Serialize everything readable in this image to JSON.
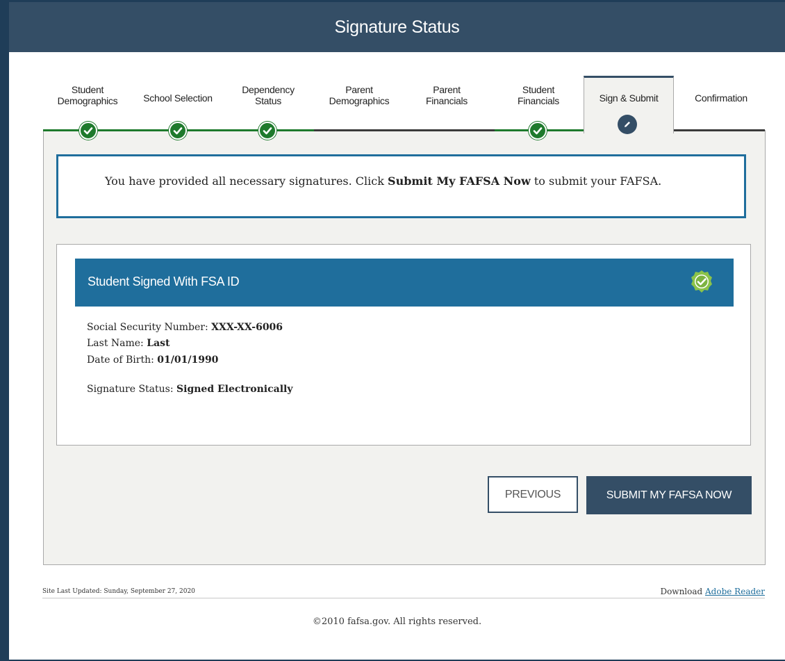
{
  "header": {
    "title": "Signature Status"
  },
  "steps": [
    {
      "label_line1": "Student",
      "label_line2": "Demographics",
      "status": "complete"
    },
    {
      "label_line1": "School Selection",
      "label_line2": "",
      "status": "complete"
    },
    {
      "label_line1": "Dependency",
      "label_line2": "Status",
      "status": "complete"
    },
    {
      "label_line1": "Parent",
      "label_line2": "Demographics",
      "status": "incomplete"
    },
    {
      "label_line1": "Parent",
      "label_line2": "Financials",
      "status": "incomplete"
    },
    {
      "label_line1": "Student",
      "label_line2": "Financials",
      "status": "complete"
    },
    {
      "label_line1": "Sign & Submit",
      "label_line2": "",
      "status": "active"
    },
    {
      "label_line1": "Confirmation",
      "label_line2": "",
      "status": "incomplete"
    }
  ],
  "notice": {
    "text_before": "You have provided all necessary signatures. Click ",
    "bold": "Submit My FAFSA Now",
    "text_after": " to submit your FAFSA."
  },
  "signature": {
    "title": "Student Signed With FSA ID",
    "ssn_label": "Social Security Number: ",
    "ssn_value": "XXX-XX-6006",
    "last_name_label": "Last Name: ",
    "last_name_value": "Last",
    "dob_label": "Date of Birth: ",
    "dob_value": "01/01/1990",
    "status_label": "Signature Status: ",
    "status_value": "Signed Electronically"
  },
  "buttons": {
    "previous": "PREVIOUS",
    "submit": "SUBMIT MY FAFSA NOW"
  },
  "footer": {
    "last_updated": "Site Last Updated: Sunday, September 27, 2020",
    "download_prefix": "Download ",
    "download_link": "Adobe Reader",
    "copyright": "©2010 fafsa.gov. All rights reserved."
  },
  "colors": {
    "header_bg": "#344e66",
    "accent_blue": "#1f6e9c",
    "complete_green": "#1e7a2c",
    "badge_green": "#8bc34a"
  },
  "icons": {
    "complete_step": "checkmark-icon",
    "active_step": "pencil-icon",
    "signature_badge": "verified-badge-icon"
  }
}
